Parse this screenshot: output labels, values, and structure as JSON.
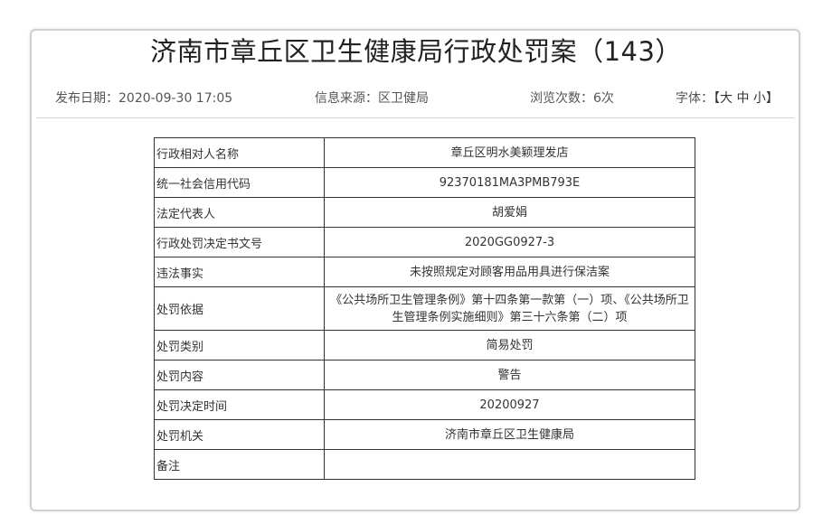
{
  "title": "济南市章丘区卫生健康局行政处罚案（143）",
  "meta": {
    "publish_label": "发布日期：",
    "publish_date": "2020-09-30 17:05",
    "source_label": "信息来源：",
    "source": "区卫健局",
    "views_label": "浏览次数：",
    "views": "6次",
    "font_label": "字体：",
    "font_options": "【大 中 小】"
  },
  "rows": [
    {
      "key": "行政相对人名称",
      "value": "章丘区明水美颖理发店"
    },
    {
      "key": "统一社会信用代码",
      "value": "92370181MA3PMB793E"
    },
    {
      "key": "法定代表人",
      "value": "胡爱娟"
    },
    {
      "key": "行政处罚决定书文号",
      "value": "2020GG0927-3"
    },
    {
      "key": "违法事实",
      "value": "未按照规定对顾客用品用具进行保洁案"
    },
    {
      "key": "处罚依据",
      "value": "《公共场所卫生管理条例》第十四条第一款第（一）项、《公共场所卫生管理条例实施细则》第三十六条第（二）项"
    },
    {
      "key": "处罚类别",
      "value": "简易处罚"
    },
    {
      "key": "处罚内容",
      "value": "警告"
    },
    {
      "key": "处罚决定时间",
      "value": "20200927"
    },
    {
      "key": "处罚机关",
      "value": "济南市章丘区卫生健康局"
    },
    {
      "key": "备注",
      "value": ""
    }
  ]
}
